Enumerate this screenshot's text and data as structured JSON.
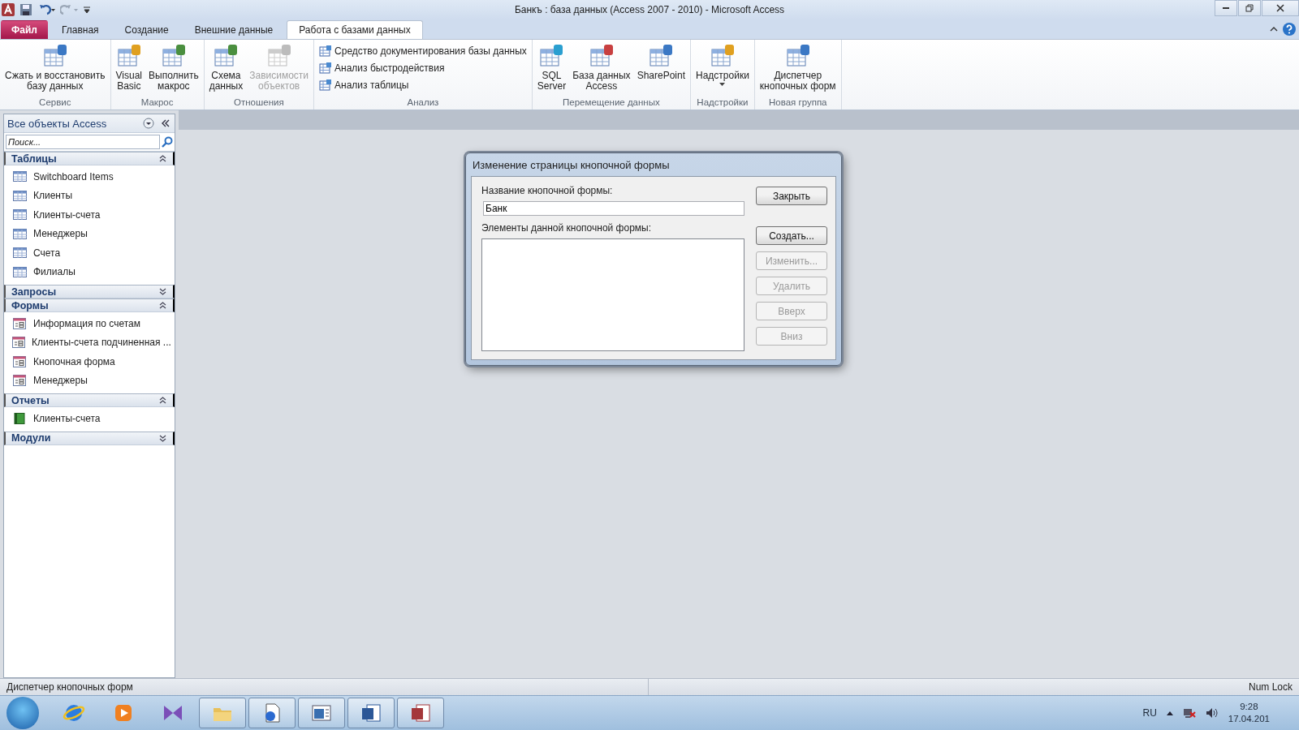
{
  "window": {
    "title": "Банкъ : база данных (Access 2007 - 2010)  -  Microsoft Access"
  },
  "ribbon_tabs": [
    {
      "label": "Файл",
      "kind": "file",
      "selected": false
    },
    {
      "label": "Главная",
      "kind": "tab",
      "selected": false
    },
    {
      "label": "Создание",
      "kind": "tab",
      "selected": false
    },
    {
      "label": "Внешние данные",
      "kind": "tab",
      "selected": false
    },
    {
      "label": "Работа с базами данных",
      "kind": "tab",
      "selected": true
    }
  ],
  "ribbon_groups": [
    {
      "label": "Сервис",
      "buttons": [
        {
          "label": "Сжать и восстановить\nбазу данных",
          "kind": "large",
          "disabled": false
        }
      ]
    },
    {
      "label": "Макрос",
      "buttons": [
        {
          "label": "Visual\nBasic",
          "kind": "large",
          "disabled": false
        },
        {
          "label": "Выполнить\nмакрос",
          "kind": "large",
          "disabled": false
        }
      ]
    },
    {
      "label": "Отношения",
      "buttons": [
        {
          "label": "Схема\nданных",
          "kind": "large",
          "disabled": false
        },
        {
          "label": "Зависимости\nобъектов",
          "kind": "large",
          "disabled": true
        }
      ]
    },
    {
      "label": "Анализ",
      "buttons": [
        {
          "label": "Средство документирования базы данных",
          "kind": "small",
          "disabled": false
        },
        {
          "label": "Анализ быстродействия",
          "kind": "small",
          "disabled": false
        },
        {
          "label": "Анализ таблицы",
          "kind": "small",
          "disabled": false
        }
      ]
    },
    {
      "label": "Перемещение данных",
      "buttons": [
        {
          "label": "SQL\nServer",
          "kind": "large",
          "disabled": false
        },
        {
          "label": "База данных\nAccess",
          "kind": "large",
          "disabled": false
        },
        {
          "label": "SharePoint",
          "kind": "large",
          "disabled": false
        }
      ]
    },
    {
      "label": "Надстройки",
      "buttons": [
        {
          "label": "Надстройки",
          "kind": "dropdown",
          "disabled": false
        }
      ]
    },
    {
      "label": "Новая группа",
      "buttons": [
        {
          "label": "Диспетчер\nкнопочных форм",
          "kind": "large",
          "disabled": false
        }
      ]
    }
  ],
  "nav_pane": {
    "title": "Все объекты Access",
    "search_placeholder": "Поиск...",
    "groups": [
      {
        "label": "Таблицы",
        "expanded": true,
        "items": [
          {
            "label": "Switchboard Items",
            "kind": "table"
          },
          {
            "label": "Клиенты",
            "kind": "table"
          },
          {
            "label": "Клиенты-счета",
            "kind": "table"
          },
          {
            "label": "Менеджеры",
            "kind": "table"
          },
          {
            "label": "Счета",
            "kind": "table"
          },
          {
            "label": "Филиалы",
            "kind": "table"
          }
        ]
      },
      {
        "label": "Запросы",
        "expanded": false
      },
      {
        "label": "Формы",
        "expanded": true,
        "items": [
          {
            "label": "Информация по счетам",
            "kind": "form"
          },
          {
            "label": "Клиенты-счета подчиненная ...",
            "kind": "form"
          },
          {
            "label": "Кнопочная форма",
            "kind": "form"
          },
          {
            "label": "Менеджеры",
            "kind": "form"
          }
        ]
      },
      {
        "label": "Отчеты",
        "expanded": true,
        "items": [
          {
            "label": "Клиенты-счета",
            "kind": "report"
          }
        ]
      },
      {
        "label": "Модули",
        "expanded": false
      }
    ]
  },
  "dialog": {
    "title": "Изменение страницы кнопочной формы",
    "name_label": "Название кнопочной формы:",
    "name_value": "Банк",
    "items_label": "Элементы данной кнопочной формы:",
    "buttons": [
      {
        "label": "Закрыть",
        "disabled": false
      },
      {
        "label": "Создать...",
        "disabled": false
      },
      {
        "label": "Изменить...",
        "disabled": true
      },
      {
        "label": "Удалить",
        "disabled": true
      },
      {
        "label": "Вверх",
        "disabled": true
      },
      {
        "label": "Вниз",
        "disabled": true
      }
    ]
  },
  "status_bar": {
    "message": "Диспетчер кнопочных форм",
    "indicator": "Num Lock"
  },
  "taskbar": {
    "apps": [
      {
        "kind": "browser",
        "running": false
      },
      {
        "kind": "media",
        "running": false
      },
      {
        "kind": "studio",
        "running": false
      },
      {
        "kind": "folder",
        "running": true
      },
      {
        "kind": "document",
        "running": true
      },
      {
        "kind": "presentation",
        "running": true
      },
      {
        "kind": "word",
        "running": true
      },
      {
        "kind": "access",
        "running": true
      }
    ],
    "language": "RU",
    "time": "9:28",
    "date": "17.04.201"
  }
}
